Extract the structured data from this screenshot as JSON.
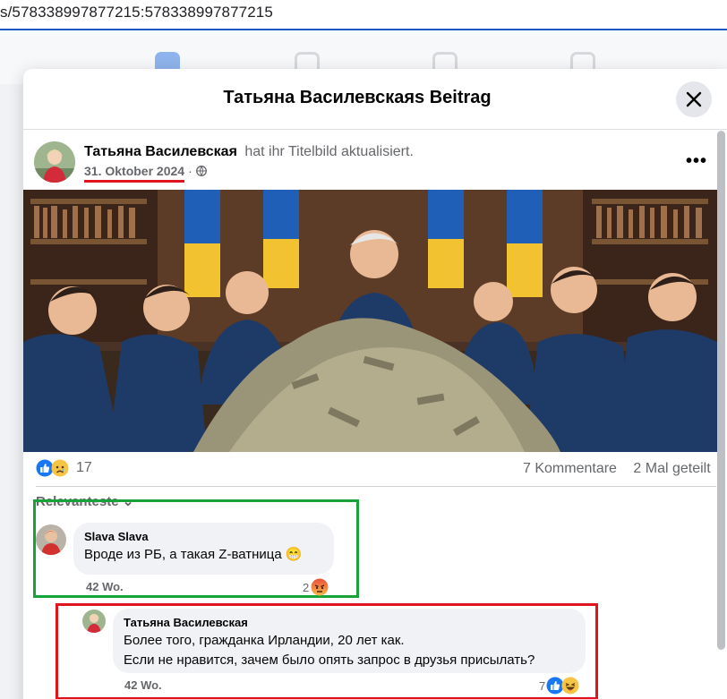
{
  "browser": {
    "url": "s/578338997877215:578338997877215"
  },
  "dialog": {
    "title": "Татьяна Василевскаяs Beitrag"
  },
  "post": {
    "author": "Татьяна Василевская",
    "action": "hat ihr Titelbild aktualisiert.",
    "date": "31. Oktober 2024",
    "separator": "·",
    "privacy_icon": "globe-icon",
    "more_label": "•••",
    "reactions": {
      "icons": [
        "like-icon",
        "sad-icon"
      ],
      "count": "17"
    },
    "comments_count": "7 Kommentare",
    "shares_count": "2 Mal geteilt"
  },
  "comments": {
    "sort_label": "Relevanteste ⌄",
    "items": [
      {
        "author": "Slava Slava",
        "text": "Вроде из РБ, а такая Z-ватница 😁",
        "time": "42 Wo.",
        "reaction_count": "2",
        "reaction_icon": "angry-icon"
      },
      {
        "author": "Татьяна Василевская",
        "text_line1": "Более того, гражданка Ирландии, 20 лет как.",
        "text_line2": "Если не нравится, зачем было опять запрос в друзья присылать?",
        "time": "42 Wo.",
        "reaction_count": "7",
        "reaction_icons": [
          "like-icon",
          "laughing-icon"
        ]
      }
    ]
  },
  "colors": {
    "highlight_green": "#17a33a",
    "highlight_red": "#e0141e",
    "facebook_blue": "#1877f2"
  }
}
